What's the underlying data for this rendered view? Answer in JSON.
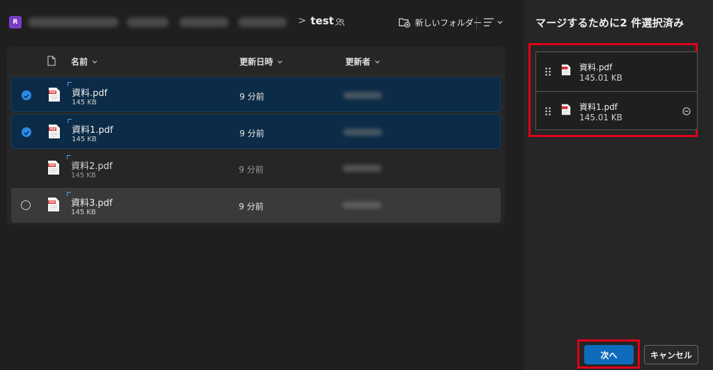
{
  "app": {
    "badge": "R"
  },
  "breadcrumb": {
    "separator": ">",
    "current": "test"
  },
  "toolbar": {
    "new_folder_label": "新しいフォルダー"
  },
  "list": {
    "headers": {
      "name": "名前",
      "modified": "更新日時",
      "modified_by": "更新者"
    },
    "rows": [
      {
        "name": "資料.pdf",
        "size": "145 KB",
        "modified": "9 分前",
        "selected": true
      },
      {
        "name": "資料1.pdf",
        "size": "145 KB",
        "modified": "9 分前",
        "selected": true
      },
      {
        "name": "資料2.pdf",
        "size": "145 KB",
        "modified": "9 分前",
        "selected": false
      },
      {
        "name": "資料3.pdf",
        "size": "145 KB",
        "modified": "9 分前",
        "selected": false
      }
    ]
  },
  "panel": {
    "title": "マージするために2 件選択済み",
    "items": [
      {
        "name": "資料.pdf",
        "size": "145.01 KB"
      },
      {
        "name": "資料1.pdf",
        "size": "145.01 KB"
      }
    ],
    "next_label": "次へ",
    "cancel_label": "キャンセル"
  },
  "colors": {
    "accent": "#0f6cbd",
    "highlight": "#e1001a",
    "selected_row": "#0c2b46",
    "badge": "#7a3ec4"
  },
  "icons": [
    "document-icon",
    "pdf-icon",
    "shared-icon",
    "folder-add-icon",
    "list-view-icon",
    "chevron-down-icon",
    "drag-handle-icon",
    "remove-icon",
    "checkmark-icon"
  ]
}
